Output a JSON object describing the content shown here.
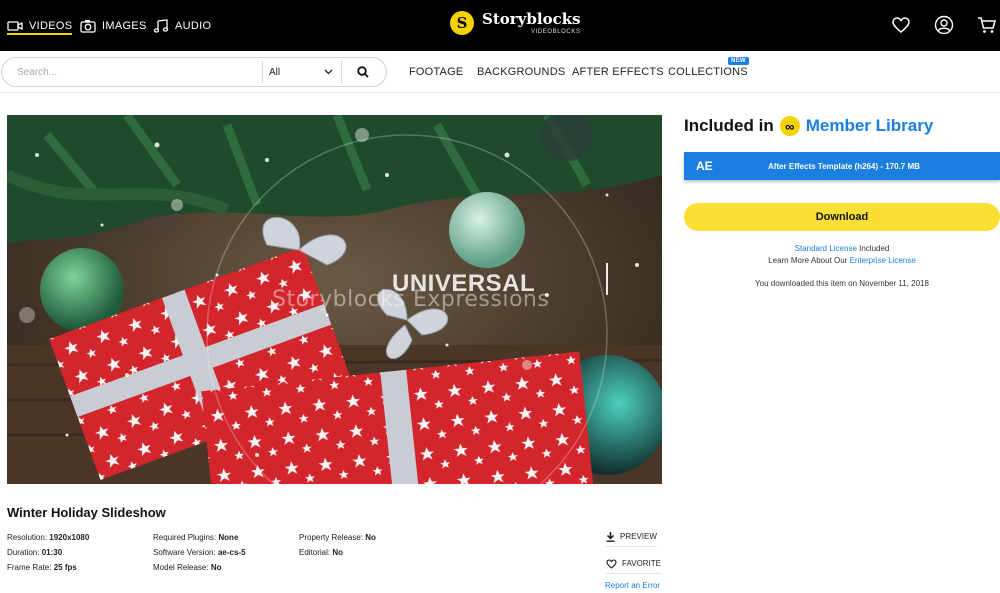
{
  "header": {
    "tabs": [
      {
        "label": "VIDEOS",
        "icon": "video-camera-icon",
        "active": true
      },
      {
        "label": "IMAGES",
        "icon": "photo-camera-icon",
        "active": false
      },
      {
        "label": "AUDIO",
        "icon": "music-note-icon",
        "active": false
      }
    ],
    "logo_name": "Storyblocks",
    "logo_sub": "VIDEOBLOCKS",
    "logo_badge": "S",
    "icons": [
      "heart-icon",
      "user-icon",
      "cart-icon"
    ]
  },
  "search": {
    "placeholder": "Search...",
    "filter_value": "All"
  },
  "nav": {
    "links": [
      "FOOTAGE",
      "BACKGROUNDS",
      "AFTER EFFECTS",
      "COLLECTIONS"
    ],
    "new_badge": "NEW"
  },
  "video": {
    "watermark_brand": "UNIVERSAL",
    "watermark_sub": "Storyblocks Expressions"
  },
  "item": {
    "title": "Winter Holiday Slideshow",
    "meta_col1": [
      {
        "label": "Resolution:",
        "value": "1920x1080"
      },
      {
        "label": "Duration:",
        "value": "01:30"
      },
      {
        "label": "Frame Rate:",
        "value": "25 fps"
      }
    ],
    "meta_col2": [
      {
        "label": "Required Plugins:",
        "value": "None"
      },
      {
        "label": "Software Version:",
        "value": "ae-cs-5"
      },
      {
        "label": "Model Release:",
        "value": "No"
      }
    ],
    "meta_col3": [
      {
        "label": "Property Release:",
        "value": "No"
      },
      {
        "label": "Editorial:",
        "value": "No"
      }
    ],
    "preview_label": "PREVIEW",
    "favorite_label": "FAVORITE",
    "report_label": "Report an Error"
  },
  "sidebar": {
    "included_prefix": "Included in",
    "member_library": "Member Library",
    "infinity_symbol": "∞",
    "format_code": "AE",
    "format_desc": "After Effects Template (h264) - 170.7 MB",
    "download_label": "Download",
    "license_link": "Standard License",
    "license_suffix": "Included",
    "learn_more_prefix": "Learn More About Our",
    "enterprise_link": "Enterprise License",
    "downloaded_note": "You downloaded this item on November 11, 2018"
  },
  "colors": {
    "accent_blue": "#1a7fe0",
    "brand_yellow": "#f5d300",
    "download_yellow": "#fbe033",
    "topbar": "#000000"
  }
}
